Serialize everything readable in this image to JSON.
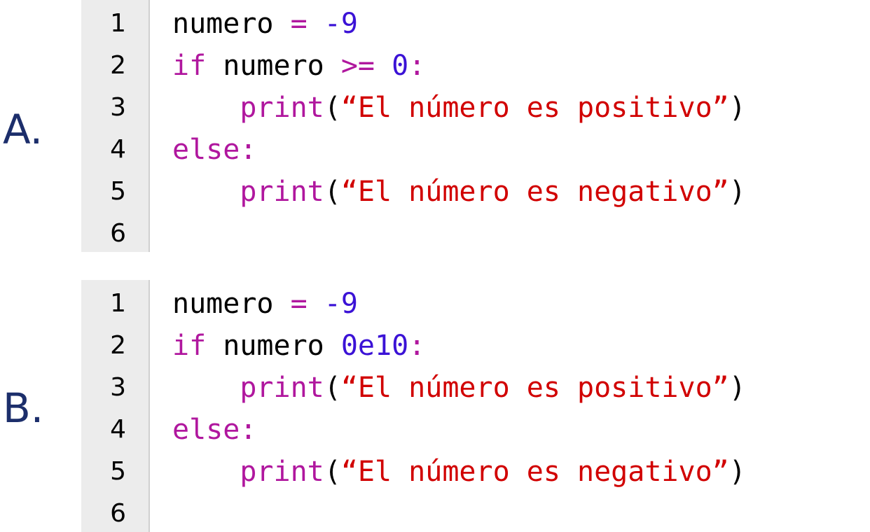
{
  "options": [
    {
      "letter": "A.",
      "line_numbers": [
        "1",
        "2",
        "3",
        "4",
        "5",
        "6"
      ],
      "lines": [
        [
          {
            "text": "numero ",
            "kind": "plain"
          },
          {
            "text": "=",
            "kind": "op"
          },
          {
            "text": " ",
            "kind": "plain"
          },
          {
            "text": "-9",
            "kind": "num"
          }
        ],
        [
          {
            "text": "if",
            "kind": "kw"
          },
          {
            "text": " numero ",
            "kind": "plain"
          },
          {
            "text": ">=",
            "kind": "op"
          },
          {
            "text": " ",
            "kind": "plain"
          },
          {
            "text": "0",
            "kind": "num"
          },
          {
            "text": ":",
            "kind": "op"
          }
        ],
        [
          {
            "text": "    ",
            "kind": "plain"
          },
          {
            "text": "print",
            "kind": "fn"
          },
          {
            "text": "(",
            "kind": "plain"
          },
          {
            "text": "“El número es positivo”",
            "kind": "str"
          },
          {
            "text": ")",
            "kind": "plain"
          }
        ],
        [
          {
            "text": "else",
            "kind": "kw"
          },
          {
            "text": ":",
            "kind": "op"
          }
        ],
        [
          {
            "text": "    ",
            "kind": "plain"
          },
          {
            "text": "print",
            "kind": "fn"
          },
          {
            "text": "(",
            "kind": "plain"
          },
          {
            "text": "“El número es negativo”",
            "kind": "str"
          },
          {
            "text": ")",
            "kind": "plain"
          }
        ],
        []
      ]
    },
    {
      "letter": "B.",
      "line_numbers": [
        "1",
        "2",
        "3",
        "4",
        "5",
        "6"
      ],
      "lines": [
        [
          {
            "text": "numero ",
            "kind": "plain"
          },
          {
            "text": "=",
            "kind": "op"
          },
          {
            "text": " ",
            "kind": "plain"
          },
          {
            "text": "-9",
            "kind": "num"
          }
        ],
        [
          {
            "text": "if",
            "kind": "kw"
          },
          {
            "text": " numero ",
            "kind": "plain"
          },
          {
            "text": "0e10",
            "kind": "num"
          },
          {
            "text": ":",
            "kind": "op"
          }
        ],
        [
          {
            "text": "    ",
            "kind": "plain"
          },
          {
            "text": "print",
            "kind": "fn"
          },
          {
            "text": "(",
            "kind": "plain"
          },
          {
            "text": "“El número es positivo”",
            "kind": "str"
          },
          {
            "text": ")",
            "kind": "plain"
          }
        ],
        [
          {
            "text": "else",
            "kind": "kw"
          },
          {
            "text": ":",
            "kind": "op"
          }
        ],
        [
          {
            "text": "    ",
            "kind": "plain"
          },
          {
            "text": "print",
            "kind": "fn"
          },
          {
            "text": "(",
            "kind": "plain"
          },
          {
            "text": "“El número es negativo”",
            "kind": "str"
          },
          {
            "text": ")",
            "kind": "plain"
          }
        ],
        []
      ]
    }
  ]
}
